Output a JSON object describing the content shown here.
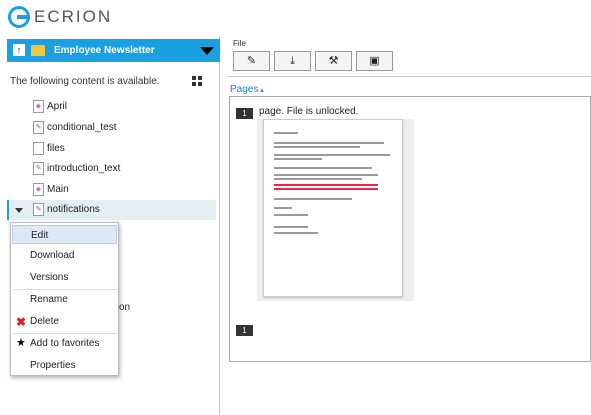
{
  "app": {
    "logo_text": "ECRION"
  },
  "sidebar": {
    "banner_title": "Employee Newsletter",
    "banner_up_glyph": "↑",
    "availability_text": "The following content is available.",
    "items": [
      {
        "label": "April",
        "icon": "document-icon"
      },
      {
        "label": "conditional_test",
        "icon": "template-icon"
      },
      {
        "label": "files",
        "icon": "file-icon"
      },
      {
        "label": "introduction_text",
        "icon": "template-icon"
      },
      {
        "label": "Main",
        "icon": "document-icon"
      },
      {
        "label": "notifications",
        "icon": "template-icon",
        "selected": true
      }
    ],
    "peek_text": "on"
  },
  "context_menu": {
    "items": [
      {
        "label": "Edit",
        "highlighted": true
      },
      {
        "label": "Download"
      },
      {
        "label": "Versions"
      },
      {
        "label": "Rename"
      },
      {
        "label": "Delete",
        "icon": "delete-x-icon"
      },
      {
        "label": "Add to favorites",
        "icon": "star-icon"
      },
      {
        "label": "Properties"
      }
    ]
  },
  "toolbar": {
    "group_label": "File",
    "buttons": [
      {
        "name": "edit-button",
        "icon": "pencil-icon",
        "glyph": "✎"
      },
      {
        "name": "download-button",
        "icon": "download-icon",
        "glyph": "⤓"
      },
      {
        "name": "tools-button",
        "icon": "tools-icon",
        "glyph": "⚒"
      },
      {
        "name": "preview-button",
        "icon": "page-settings-icon",
        "glyph": "▣"
      }
    ]
  },
  "pages_panel": {
    "title": "Pages",
    "status_text": "page. File is unlocked.",
    "page_number_top": "1",
    "page_number_bottom": "1"
  },
  "colors": {
    "accent": "#1aa0e0",
    "selection": "#e4edf2"
  }
}
